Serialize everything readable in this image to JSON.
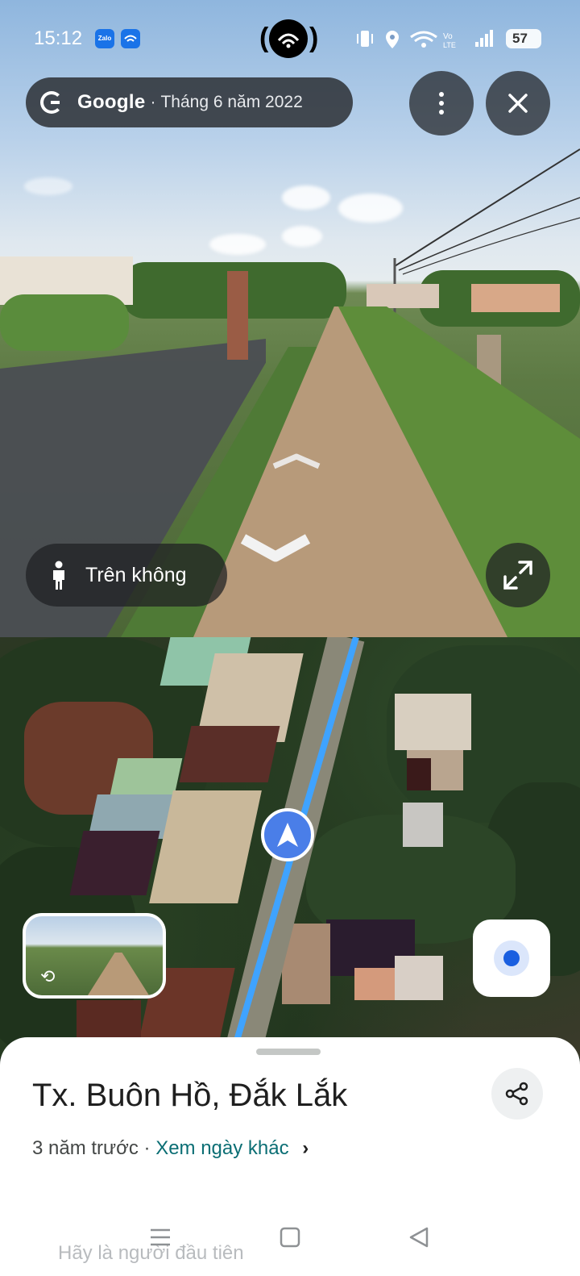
{
  "status_bar": {
    "time": "15:12",
    "battery": "57"
  },
  "street_view": {
    "brand": "Google",
    "separator": "·",
    "date": "Tháng 6 năm 2022",
    "aerial_label": "Trên không"
  },
  "sheet": {
    "place_name": "Tx. Buôn Hồ, Đắk Lắk",
    "age": "3 năm trước",
    "separator": "·",
    "other_dates_link": "Xem ngày khác",
    "next_hint": "Hãy là người đầu tiên"
  },
  "colors": {
    "route_blue": "#3fa3ff",
    "location_blue": "#1a5fe0",
    "link_teal": "#0b6e74"
  },
  "icons": [
    "zalo-icon",
    "wifi-app-icon",
    "camera-notch-icon",
    "vibrate-icon",
    "location-icon",
    "wifi-icon",
    "volte-icon",
    "signal-icon",
    "battery-icon",
    "google-g-icon",
    "more-vert-icon",
    "close-icon",
    "person-icon",
    "chevron-up-icon",
    "chevron-down-icon",
    "expand-icon",
    "rotate-360-icon",
    "my-location-icon",
    "navigation-arrow-icon",
    "share-icon",
    "chevron-right-icon",
    "menu-icon",
    "home-square-icon",
    "back-triangle-icon"
  ]
}
